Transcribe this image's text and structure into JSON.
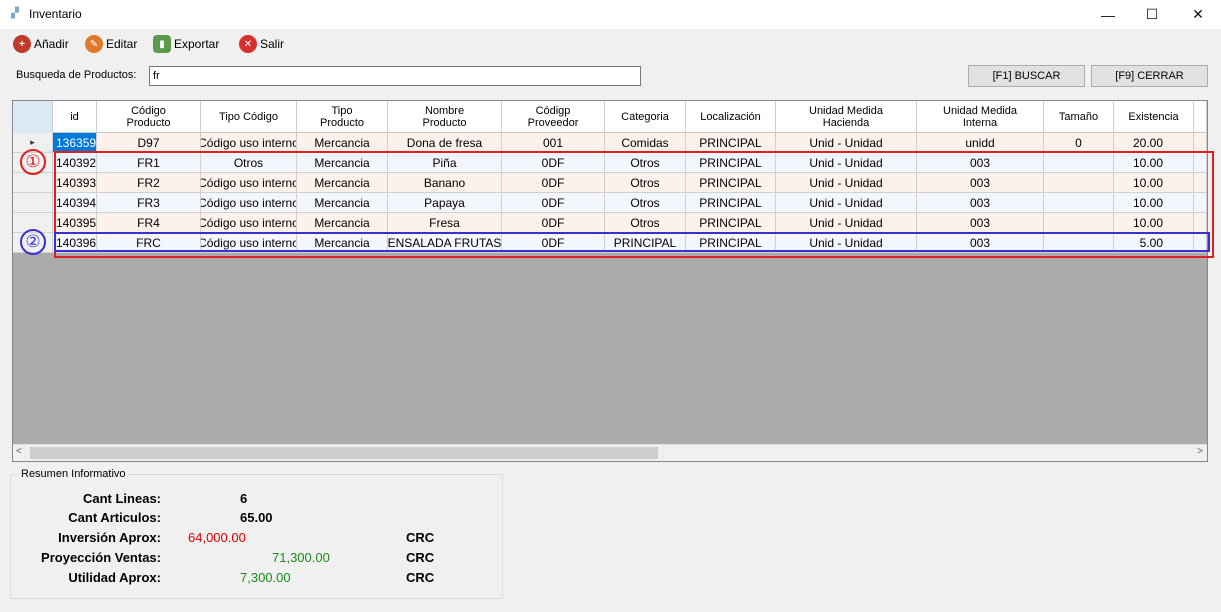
{
  "window": {
    "title": "Inventario",
    "controls": {
      "minimize": "—",
      "maximize": "☐",
      "close": "✕"
    }
  },
  "toolbar": {
    "add_label": "Añadir",
    "edit_label": "Editar",
    "export_label": "Exportar",
    "exit_label": "Salir"
  },
  "search": {
    "label": "Busqueda de Productos:",
    "value": "fr",
    "search_button": "[F1] BUSCAR",
    "close_button": "[F9] CERRAR"
  },
  "grid": {
    "columns": [
      "",
      "id",
      "Código\nProducto",
      "Tipo Código",
      "Tipo\nProducto",
      "Nombre\nProducto",
      "Códigp\nProveedor",
      "Categoria",
      "Localización",
      "Unidad Medida\nHacienda",
      "Unidad Medida\nInterna",
      "Tamaño",
      "Existencia",
      ""
    ],
    "rows": [
      [
        "▸",
        "136359",
        "D97",
        "Código uso interno",
        "Mercancia",
        "Dona de fresa",
        "001",
        "Comidas",
        "PRINCIPAL",
        "Unid - Unidad",
        "unidd",
        "0",
        "20.00",
        ""
      ],
      [
        "",
        "140392",
        "FR1",
        "Otros",
        "Mercancia",
        "Piña",
        "0DF",
        "Otros",
        "PRINCIPAL",
        "Unid - Unidad",
        "003",
        "",
        "10.00",
        ""
      ],
      [
        "",
        "140393",
        "FR2",
        "Código uso interno",
        "Mercancia",
        "Banano",
        "0DF",
        "Otros",
        "PRINCIPAL",
        "Unid - Unidad",
        "003",
        "",
        "10.00",
        ""
      ],
      [
        "",
        "140394",
        "FR3",
        "Código uso interno",
        "Mercancia",
        "Papaya",
        "0DF",
        "Otros",
        "PRINCIPAL",
        "Unid - Unidad",
        "003",
        "",
        "10.00",
        ""
      ],
      [
        "",
        "140395",
        "FR4",
        "Código uso interno",
        "Mercancia",
        "Fresa",
        "0DF",
        "Otros",
        "PRINCIPAL",
        "Unid - Unidad",
        "003",
        "",
        "10.00",
        ""
      ],
      [
        "",
        "140396",
        "FRC",
        "Código uso interno",
        "Mercancia",
        "ENSALADA FRUTAS",
        "0DF",
        "PRINCIPAL",
        "PRINCIPAL",
        "Unid - Unidad",
        "003",
        "",
        "5.00",
        ""
      ]
    ]
  },
  "annotations": {
    "one": "①",
    "two": "②",
    "red": "#e02020",
    "blue": "#3a2fd0"
  },
  "summary": {
    "legend": "Resumen Informativo",
    "lines_label": "Cant Lineas:",
    "lines_value": "6",
    "articles_label": "Cant Articulos:",
    "articles_value": "65.00",
    "investment_label": "Inversión Aprox:",
    "investment_value": "64,000.00",
    "investment_currency": "CRC",
    "sales_label": "Proyección Ventas:",
    "sales_value": "71,300.00",
    "sales_currency": "CRC",
    "profit_label": "Utilidad Aprox:",
    "profit_value": "7,300.00",
    "profit_currency": "CRC",
    "colors": {
      "red": "#e00000",
      "green": "#1a8a1a"
    }
  }
}
